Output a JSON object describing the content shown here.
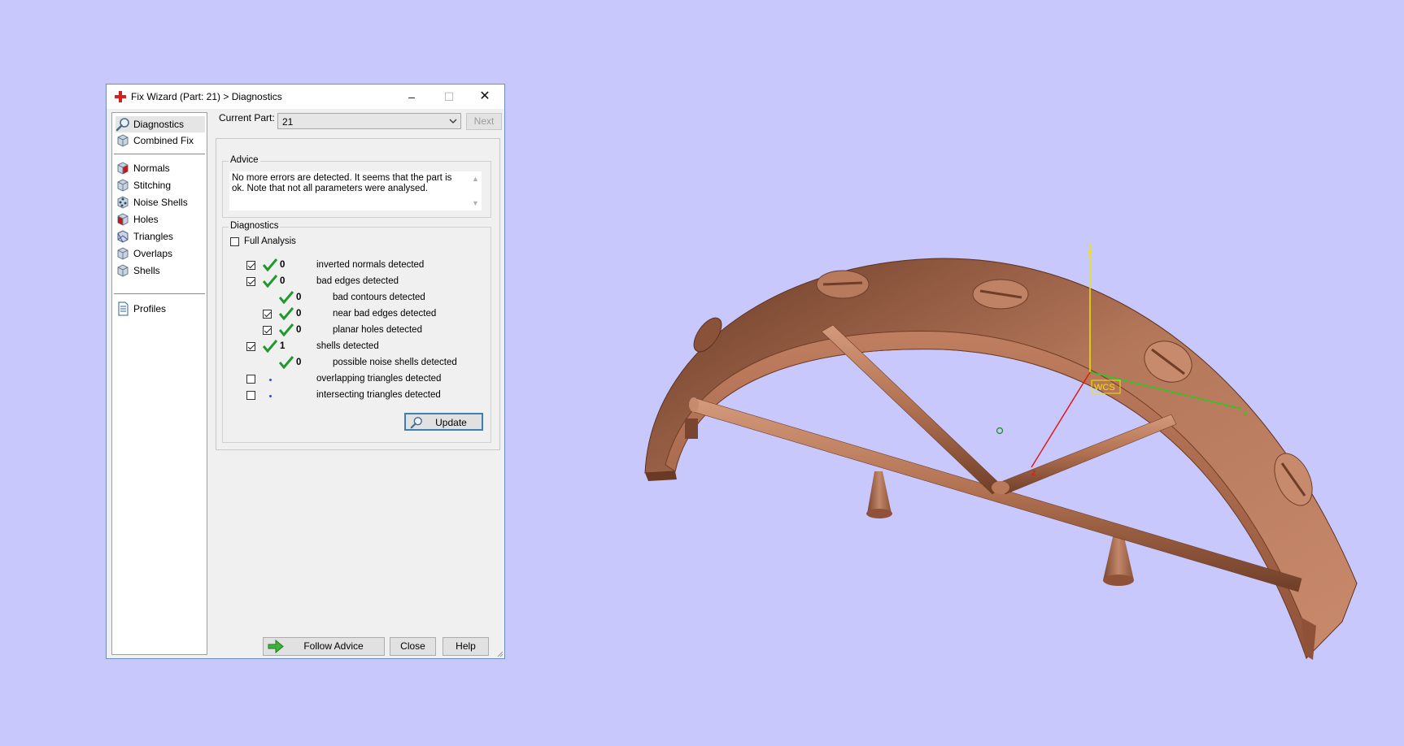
{
  "window": {
    "title": "Fix Wizard (Part: 21) > Diagnostics",
    "minimize": "–",
    "maximize": "☐",
    "close": "✕"
  },
  "nav": {
    "items": [
      {
        "label": "Diagnostics",
        "icon": "magnifier-icon"
      },
      {
        "label": "Combined Fix",
        "icon": "cube-icon"
      },
      {
        "label": "Normals",
        "icon": "cube-red-face-icon"
      },
      {
        "label": "Stitching",
        "icon": "cube-icon"
      },
      {
        "label": "Noise Shells",
        "icon": "cube-dots-icon"
      },
      {
        "label": "Holes",
        "icon": "cube-hole-icon"
      },
      {
        "label": "Triangles",
        "icon": "cube-triangles-icon"
      },
      {
        "label": "Overlaps",
        "icon": "cube-icon"
      },
      {
        "label": "Shells",
        "icon": "cube-icon"
      },
      {
        "label": "Profiles",
        "icon": "document-icon"
      }
    ]
  },
  "header": {
    "current_part_label": "Current Part:",
    "current_part_value": "21",
    "next_label": "Next"
  },
  "advice": {
    "title": "Advice",
    "text": "No more errors are detected. It seems that the part is ok. Note that not all parameters were analysed."
  },
  "diagnostics": {
    "title": "Diagnostics",
    "full_analysis_label": "Full Analysis",
    "full_analysis_checked": false,
    "rows": [
      {
        "checked": true,
        "has_checkbox": true,
        "status": "ok",
        "count": "0",
        "label": "inverted normals detected",
        "indent": 0
      },
      {
        "checked": true,
        "has_checkbox": true,
        "status": "ok",
        "count": "0",
        "label": "bad edges detected",
        "indent": 0
      },
      {
        "checked": false,
        "has_checkbox": false,
        "status": "ok",
        "count": "0",
        "label": "bad contours detected",
        "indent": 1
      },
      {
        "checked": true,
        "has_checkbox": true,
        "status": "ok",
        "count": "0",
        "label": "near bad edges detected",
        "indent": 1
      },
      {
        "checked": true,
        "has_checkbox": true,
        "status": "ok",
        "count": "0",
        "label": "planar holes detected",
        "indent": 1
      },
      {
        "checked": true,
        "has_checkbox": true,
        "status": "ok",
        "count": "1",
        "label": "shells detected",
        "indent": 0
      },
      {
        "checked": false,
        "has_checkbox": false,
        "status": "ok",
        "count": "0",
        "label": "possible noise shells detected",
        "indent": 1
      },
      {
        "checked": false,
        "has_checkbox": true,
        "status": "pending",
        "count": "",
        "label": "overlapping triangles detected",
        "indent": 0
      },
      {
        "checked": false,
        "has_checkbox": true,
        "status": "pending",
        "count": "",
        "label": "intersecting triangles detected",
        "indent": 0
      }
    ],
    "update_label": "Update"
  },
  "footer": {
    "follow_advice_label": "Follow Advice",
    "close_label": "Close",
    "help_label": "Help"
  },
  "viewport": {
    "axis_y": "y",
    "axis_x": "x",
    "axis_z": "z",
    "wcs_label": "WCS",
    "model_color": "#a8694c"
  },
  "colors": {
    "background": "#c8c8fc",
    "tick_green": "#1e9a2c",
    "accent_blue": "#3c7fb1"
  }
}
